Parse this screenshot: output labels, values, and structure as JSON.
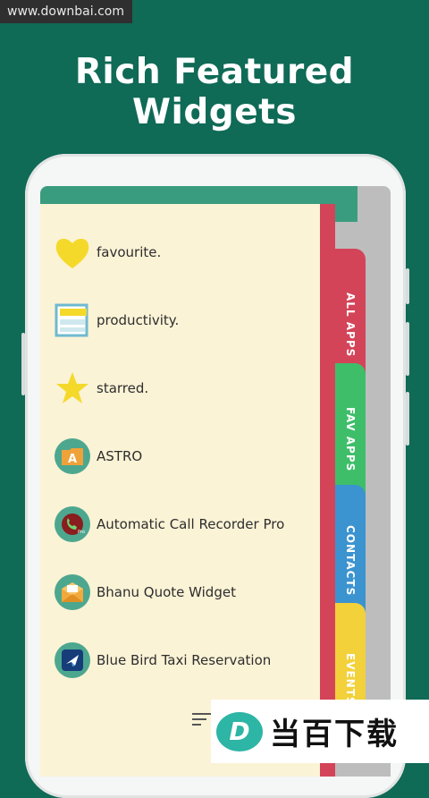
{
  "watermark_top": "www.downbai.com",
  "headline": "Rich Featured Widgets",
  "items": [
    {
      "label": "favourite.",
      "icon": "heart-icon"
    },
    {
      "label": "productivity.",
      "icon": "notepad-icon"
    },
    {
      "label": "starred.",
      "icon": "star-icon"
    },
    {
      "label": "ASTRO",
      "icon": "astro-folder-icon"
    },
    {
      "label": "Automatic Call Recorder Pro",
      "icon": "call-recorder-icon"
    },
    {
      "label": "Bhanu Quote Widget",
      "icon": "envelope-icon"
    },
    {
      "label": "Blue Bird Taxi Reservation",
      "icon": "taxi-icon"
    }
  ],
  "tabs": [
    {
      "label": "ALL APPS",
      "color": "#d44459"
    },
    {
      "label": "FAV APPS",
      "color": "#3fbe6a"
    },
    {
      "label": "CONTACTS",
      "color": "#3b93cf"
    },
    {
      "label": "EVENTS",
      "color": "#f2d13b"
    }
  ],
  "watermark_bottom": {
    "logo": "D",
    "text": "当百下载"
  },
  "colors": {
    "background": "#0f6a56",
    "panel": "#fbf3d6",
    "header": "#3a9c7e"
  }
}
